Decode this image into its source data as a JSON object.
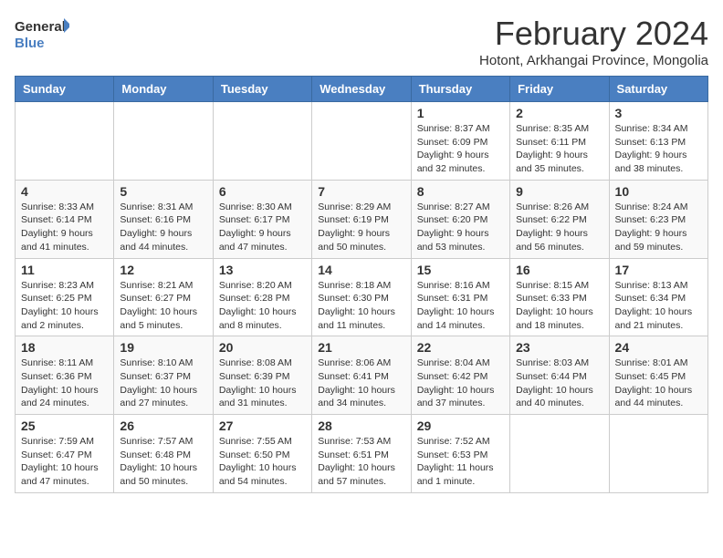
{
  "logo": {
    "line1": "General",
    "line2": "Blue"
  },
  "title": "February 2024",
  "subtitle": "Hotont, Arkhangai Province, Mongolia",
  "weekdays": [
    "Sunday",
    "Monday",
    "Tuesday",
    "Wednesday",
    "Thursday",
    "Friday",
    "Saturday"
  ],
  "weeks": [
    [
      {
        "day": "",
        "info": ""
      },
      {
        "day": "",
        "info": ""
      },
      {
        "day": "",
        "info": ""
      },
      {
        "day": "",
        "info": ""
      },
      {
        "day": "1",
        "info": "Sunrise: 8:37 AM\nSunset: 6:09 PM\nDaylight: 9 hours and 32 minutes."
      },
      {
        "day": "2",
        "info": "Sunrise: 8:35 AM\nSunset: 6:11 PM\nDaylight: 9 hours and 35 minutes."
      },
      {
        "day": "3",
        "info": "Sunrise: 8:34 AM\nSunset: 6:13 PM\nDaylight: 9 hours and 38 minutes."
      }
    ],
    [
      {
        "day": "4",
        "info": "Sunrise: 8:33 AM\nSunset: 6:14 PM\nDaylight: 9 hours and 41 minutes."
      },
      {
        "day": "5",
        "info": "Sunrise: 8:31 AM\nSunset: 6:16 PM\nDaylight: 9 hours and 44 minutes."
      },
      {
        "day": "6",
        "info": "Sunrise: 8:30 AM\nSunset: 6:17 PM\nDaylight: 9 hours and 47 minutes."
      },
      {
        "day": "7",
        "info": "Sunrise: 8:29 AM\nSunset: 6:19 PM\nDaylight: 9 hours and 50 minutes."
      },
      {
        "day": "8",
        "info": "Sunrise: 8:27 AM\nSunset: 6:20 PM\nDaylight: 9 hours and 53 minutes."
      },
      {
        "day": "9",
        "info": "Sunrise: 8:26 AM\nSunset: 6:22 PM\nDaylight: 9 hours and 56 minutes."
      },
      {
        "day": "10",
        "info": "Sunrise: 8:24 AM\nSunset: 6:23 PM\nDaylight: 9 hours and 59 minutes."
      }
    ],
    [
      {
        "day": "11",
        "info": "Sunrise: 8:23 AM\nSunset: 6:25 PM\nDaylight: 10 hours and 2 minutes."
      },
      {
        "day": "12",
        "info": "Sunrise: 8:21 AM\nSunset: 6:27 PM\nDaylight: 10 hours and 5 minutes."
      },
      {
        "day": "13",
        "info": "Sunrise: 8:20 AM\nSunset: 6:28 PM\nDaylight: 10 hours and 8 minutes."
      },
      {
        "day": "14",
        "info": "Sunrise: 8:18 AM\nSunset: 6:30 PM\nDaylight: 10 hours and 11 minutes."
      },
      {
        "day": "15",
        "info": "Sunrise: 8:16 AM\nSunset: 6:31 PM\nDaylight: 10 hours and 14 minutes."
      },
      {
        "day": "16",
        "info": "Sunrise: 8:15 AM\nSunset: 6:33 PM\nDaylight: 10 hours and 18 minutes."
      },
      {
        "day": "17",
        "info": "Sunrise: 8:13 AM\nSunset: 6:34 PM\nDaylight: 10 hours and 21 minutes."
      }
    ],
    [
      {
        "day": "18",
        "info": "Sunrise: 8:11 AM\nSunset: 6:36 PM\nDaylight: 10 hours and 24 minutes."
      },
      {
        "day": "19",
        "info": "Sunrise: 8:10 AM\nSunset: 6:37 PM\nDaylight: 10 hours and 27 minutes."
      },
      {
        "day": "20",
        "info": "Sunrise: 8:08 AM\nSunset: 6:39 PM\nDaylight: 10 hours and 31 minutes."
      },
      {
        "day": "21",
        "info": "Sunrise: 8:06 AM\nSunset: 6:41 PM\nDaylight: 10 hours and 34 minutes."
      },
      {
        "day": "22",
        "info": "Sunrise: 8:04 AM\nSunset: 6:42 PM\nDaylight: 10 hours and 37 minutes."
      },
      {
        "day": "23",
        "info": "Sunrise: 8:03 AM\nSunset: 6:44 PM\nDaylight: 10 hours and 40 minutes."
      },
      {
        "day": "24",
        "info": "Sunrise: 8:01 AM\nSunset: 6:45 PM\nDaylight: 10 hours and 44 minutes."
      }
    ],
    [
      {
        "day": "25",
        "info": "Sunrise: 7:59 AM\nSunset: 6:47 PM\nDaylight: 10 hours and 47 minutes."
      },
      {
        "day": "26",
        "info": "Sunrise: 7:57 AM\nSunset: 6:48 PM\nDaylight: 10 hours and 50 minutes."
      },
      {
        "day": "27",
        "info": "Sunrise: 7:55 AM\nSunset: 6:50 PM\nDaylight: 10 hours and 54 minutes."
      },
      {
        "day": "28",
        "info": "Sunrise: 7:53 AM\nSunset: 6:51 PM\nDaylight: 10 hours and 57 minutes."
      },
      {
        "day": "29",
        "info": "Sunrise: 7:52 AM\nSunset: 6:53 PM\nDaylight: 11 hours and 1 minute."
      },
      {
        "day": "",
        "info": ""
      },
      {
        "day": "",
        "info": ""
      }
    ]
  ]
}
